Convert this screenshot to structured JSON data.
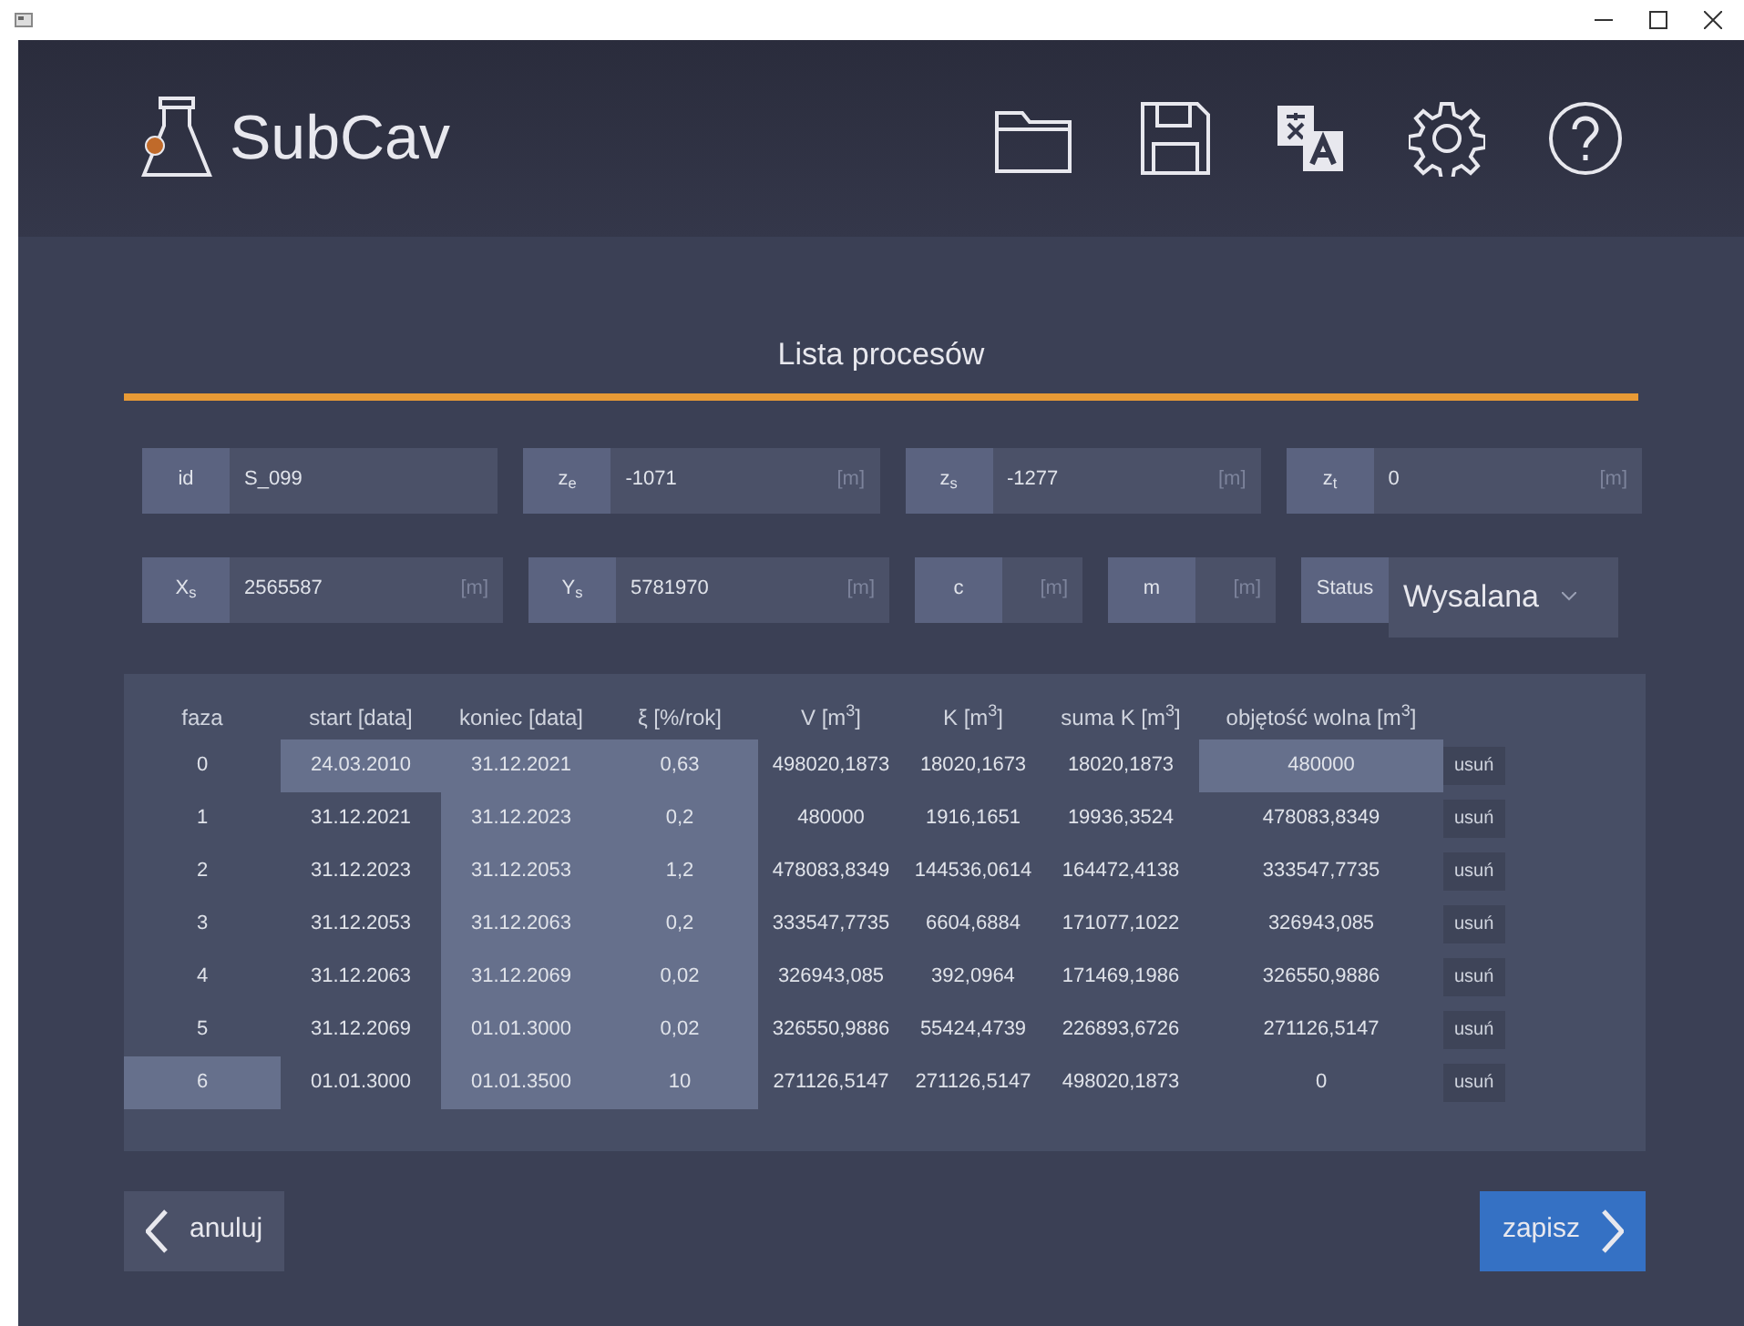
{
  "app": {
    "name": "SubCav"
  },
  "page_title": "Lista procesów",
  "fields_row1": [
    {
      "label": "id",
      "value": "S_099"
    },
    {
      "label": "z$_{e}$",
      "value": "-1071",
      "unit": "[m]"
    },
    {
      "label": "z$_{s}$",
      "value": "-1277",
      "unit": "[m]"
    },
    {
      "label": "z$_{t}$",
      "value": "0",
      "unit": "[m]"
    }
  ],
  "fields_row2": [
    {
      "label": "X$_{s}$",
      "value": "2565587",
      "unit": "[m]",
      "kind": "wide"
    },
    {
      "label": "Y$_{s}$",
      "value": "5781970",
      "unit": "[m]",
      "kind": "wide"
    },
    {
      "label": "c",
      "unit": "[m]",
      "kind": "narrow"
    },
    {
      "label": "m",
      "unit": "[m]",
      "kind": "narrow"
    }
  ],
  "status": {
    "label": "Status",
    "value": "Wysalana"
  },
  "table": {
    "columns": [
      "faza",
      "start [data]",
      "koniec [data]",
      "ξ [%/rok]",
      "V [m$^{3}$]",
      "K [m$^{3}$]",
      "suma K [m$^{3}$]",
      "objętość wolna [m$^{3}$]"
    ],
    "rows": [
      {
        "cells": [
          {
            "text": "0",
            "highlighted": false
          },
          {
            "text": "24.03.2010",
            "highlighted": true
          },
          {
            "text": "31.12.2021",
            "highlighted": true
          },
          {
            "text": "0,63",
            "highlighted": true
          },
          {
            "text": "498020,1873",
            "highlighted": false
          },
          {
            "text": "18020,1673",
            "highlighted": false
          },
          {
            "text": "18020,1873",
            "highlighted": false
          },
          {
            "text": "480000",
            "highlighted": true
          }
        ],
        "action": "usuń"
      },
      {
        "cells": [
          {
            "text": "1",
            "highlighted": false
          },
          {
            "text": "31.12.2021",
            "highlighted": false
          },
          {
            "text": "31.12.2023",
            "highlighted": true
          },
          {
            "text": "0,2",
            "highlighted": true
          },
          {
            "text": "480000",
            "highlighted": false
          },
          {
            "text": "1916,1651",
            "highlighted": false
          },
          {
            "text": "19936,3524",
            "highlighted": false
          },
          {
            "text": "478083,8349",
            "highlighted": false
          }
        ],
        "action": "usuń"
      },
      {
        "cells": [
          {
            "text": "2",
            "highlighted": false
          },
          {
            "text": "31.12.2023",
            "highlighted": false
          },
          {
            "text": "31.12.2053",
            "highlighted": true
          },
          {
            "text": "1,2",
            "highlighted": true
          },
          {
            "text": "478083,8349",
            "highlighted": false
          },
          {
            "text": "144536,0614",
            "highlighted": false
          },
          {
            "text": "164472,4138",
            "highlighted": false
          },
          {
            "text": "333547,7735",
            "highlighted": false
          }
        ],
        "action": "usuń"
      },
      {
        "cells": [
          {
            "text": "3",
            "highlighted": false
          },
          {
            "text": "31.12.2053",
            "highlighted": false
          },
          {
            "text": "31.12.2063",
            "highlighted": true
          },
          {
            "text": "0,2",
            "highlighted": true
          },
          {
            "text": "333547,7735",
            "highlighted": false
          },
          {
            "text": "6604,6884",
            "highlighted": false
          },
          {
            "text": "171077,1022",
            "highlighted": false
          },
          {
            "text": "326943,085",
            "highlighted": false
          }
        ],
        "action": "usuń"
      },
      {
        "cells": [
          {
            "text": "4",
            "highlighted": false
          },
          {
            "text": "31.12.2063",
            "highlighted": false
          },
          {
            "text": "31.12.2069",
            "highlighted": true
          },
          {
            "text": "0,02",
            "highlighted": true
          },
          {
            "text": "326943,085",
            "highlighted": false
          },
          {
            "text": "392,0964",
            "highlighted": false
          },
          {
            "text": "171469,1986",
            "highlighted": false
          },
          {
            "text": "326550,9886",
            "highlighted": false
          }
        ],
        "action": "usuń"
      },
      {
        "cells": [
          {
            "text": "5",
            "highlighted": false
          },
          {
            "text": "31.12.2069",
            "highlighted": false
          },
          {
            "text": "01.01.3000",
            "highlighted": true
          },
          {
            "text": "0,02",
            "highlighted": true
          },
          {
            "text": "326550,9886",
            "highlighted": false
          },
          {
            "text": "55424,4739",
            "highlighted": false
          },
          {
            "text": "226893,6726",
            "highlighted": false
          },
          {
            "text": "271126,5147",
            "highlighted": false
          }
        ],
        "action": "usuń"
      },
      {
        "cells": [
          {
            "text": "6",
            "highlighted": true
          },
          {
            "text": "01.01.3000",
            "highlighted": false
          },
          {
            "text": "01.01.3500",
            "highlighted": true
          },
          {
            "text": "10",
            "highlighted": true
          },
          {
            "text": "271126,5147",
            "highlighted": false
          },
          {
            "text": "271126,5147",
            "highlighted": false
          },
          {
            "text": "498020,1873",
            "highlighted": false
          },
          {
            "text": "0",
            "highlighted": false
          }
        ],
        "action": "usuń"
      }
    ]
  },
  "buttons": {
    "cancel": "anuluj",
    "save": "zapisz"
  }
}
